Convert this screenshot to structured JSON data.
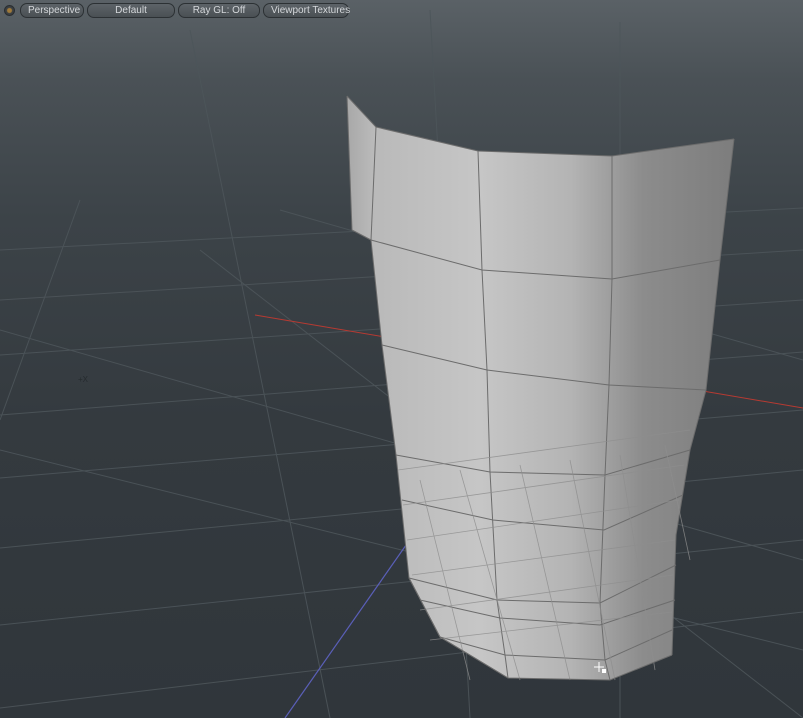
{
  "toolbar": {
    "view_projection": "Perspective",
    "shading_mode": "Default",
    "ray_gl": "Ray GL: Off",
    "textures": "Viewport Textures"
  },
  "viewport": {
    "axis_marker": "+X"
  },
  "colors": {
    "background_top": "#5a6166",
    "background_bottom": "#30363b",
    "grid": "#4f565b",
    "x_axis": "#b73a32",
    "z_axis": "#5a5fb8",
    "mesh_light": "#c2c2c2",
    "mesh_dark": "#7a7a7a",
    "mesh_wire": "#6a6a6a"
  },
  "icons": {
    "viewport_menu": "viewport-menu-icon",
    "cursor": "move-cursor-icon"
  }
}
